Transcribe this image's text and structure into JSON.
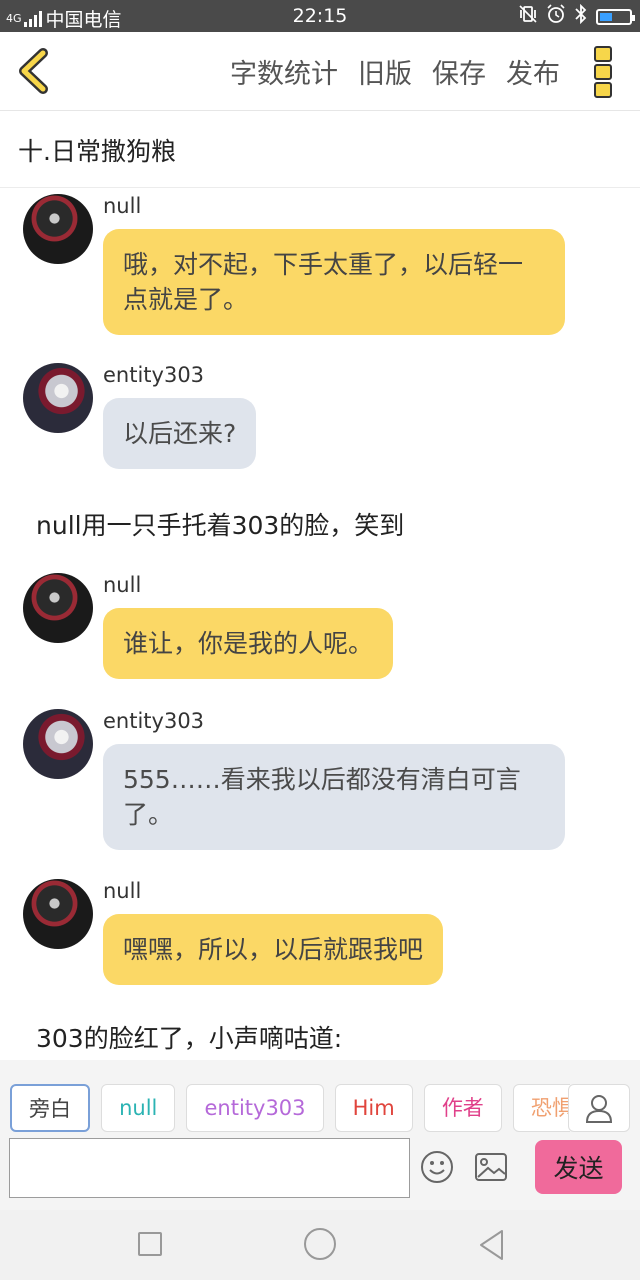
{
  "status_bar": {
    "network": "4G",
    "carrier": "中国电信",
    "time": "22:15"
  },
  "toolbar": {
    "word_count": "字数统计",
    "old_version": "旧版",
    "save": "保存",
    "publish": "发布"
  },
  "chapter": {
    "title": "十.日常撒狗粮"
  },
  "messages": [
    {
      "speaker": "null",
      "text": "哦，对不起，下手太重了，以后轻一点就是了。"
    },
    {
      "speaker": "entity303",
      "text": "以后还来?"
    },
    {
      "narration": "null用一只手托着303的脸，笑到"
    },
    {
      "speaker": "null",
      "text": "谁让，你是我的人呢。"
    },
    {
      "speaker": "entity303",
      "text": "555……看来我以后都没有清白可言了。"
    },
    {
      "speaker": "null",
      "text": "嘿嘿，所以，以后就跟我吧"
    },
    {
      "narration": "303的脸红了，小声嘀咕道:"
    }
  ],
  "roles": [
    {
      "label": "旁白",
      "color": "#444444"
    },
    {
      "label": "null",
      "color": "#2bb3b3"
    },
    {
      "label": "entity303",
      "color": "#b569d9"
    },
    {
      "label": "Him",
      "color": "#e0443c"
    },
    {
      "label": "作者",
      "color": "#e0408a"
    },
    {
      "label": "恐惧魔",
      "color": "#f0a070"
    }
  ],
  "composer": {
    "input_value": "",
    "send": "发送"
  },
  "colors": {
    "accent_yellow": "#fbd866",
    "bubble_gray": "#dfe4ec",
    "send_pink": "#f06a9b"
  }
}
